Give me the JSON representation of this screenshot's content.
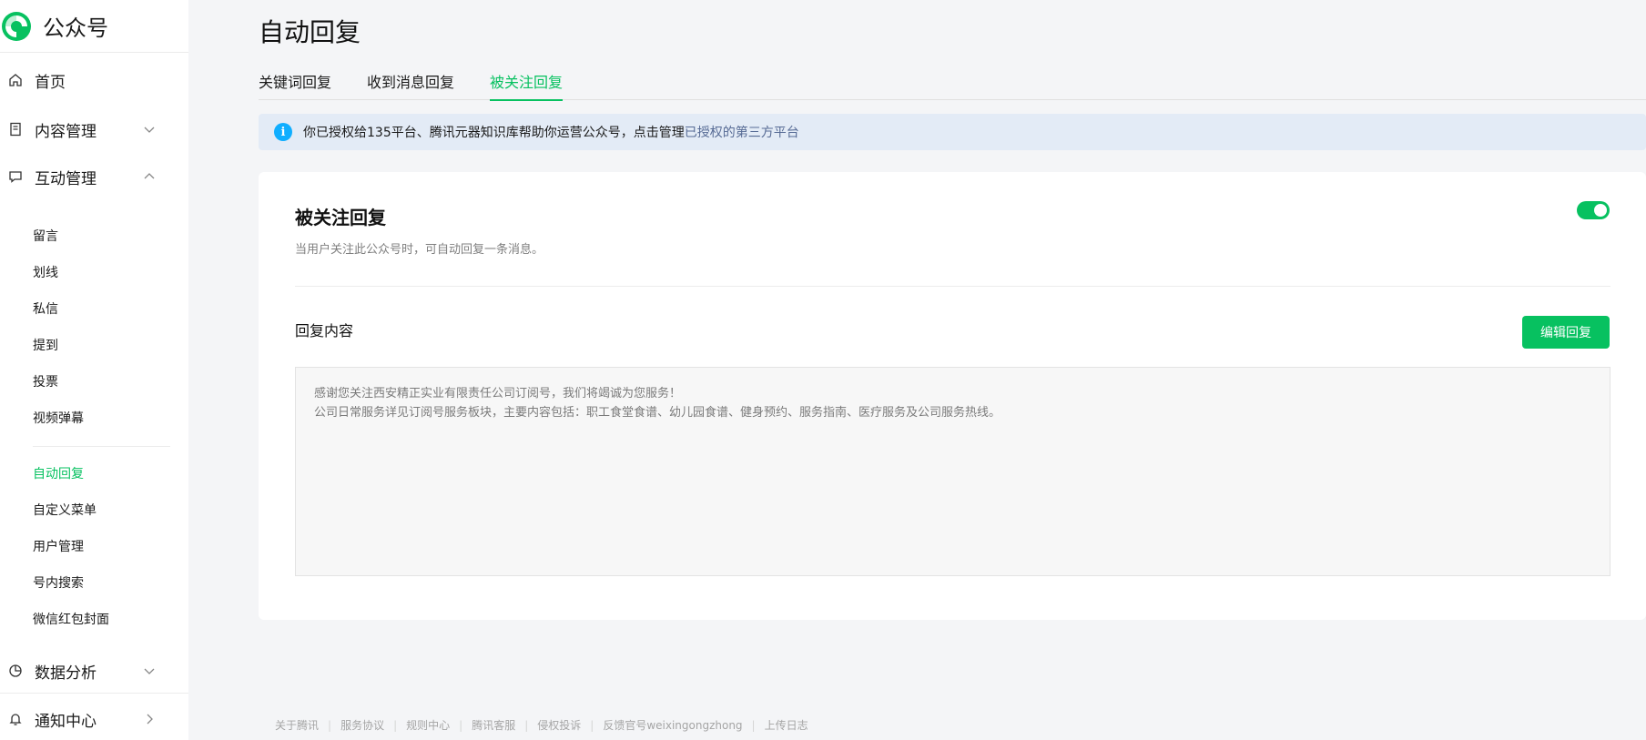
{
  "brand": {
    "name": "公众号",
    "logo_icon": "wechat-mp-logo-icon",
    "accent": "#07c160"
  },
  "sidebar": {
    "top_items": [
      {
        "label": "首页",
        "icon": "home-icon"
      },
      {
        "label": "内容管理",
        "icon": "document-icon",
        "expanded": false
      },
      {
        "label": "互动管理",
        "icon": "chat-bubble-icon",
        "expanded": true
      }
    ],
    "interaction_items": [
      {
        "label": "留言"
      },
      {
        "label": "划线"
      },
      {
        "label": "私信"
      },
      {
        "label": "提到"
      },
      {
        "label": "投票"
      },
      {
        "label": "视频弹幕"
      }
    ],
    "reply_items": [
      {
        "label": "自动回复",
        "active": true
      },
      {
        "label": "自定义菜单"
      },
      {
        "label": "用户管理"
      },
      {
        "label": "号内搜索"
      },
      {
        "label": "微信红包封面"
      }
    ],
    "bottom_items": [
      {
        "label": "数据分析",
        "icon": "pie-chart-icon"
      },
      {
        "label": "通知中心",
        "icon": "bell-icon"
      }
    ]
  },
  "page": {
    "title": "自动回复"
  },
  "tabs": [
    {
      "label": "关键词回复",
      "active": false
    },
    {
      "label": "收到消息回复",
      "active": false
    },
    {
      "label": "被关注回复",
      "active": true
    }
  ],
  "notice": {
    "text": "你已授权给135平台、腾讯元器知识库帮助你运营公众号，点击管理",
    "link": "已授权的第三方平台"
  },
  "card": {
    "title": "被关注回复",
    "description": "当用户关注此公众号时，可自动回复一条消息。",
    "toggle_on": true,
    "reply_label": "回复内容",
    "edit_button": "编辑回复",
    "reply_lines": [
      "感谢您关注西安精正实业有限责任公司订阅号，我们将竭诚为您服务！",
      "公司日常服务详见订阅号服务板块，主要内容包括：职工食堂食谱、幼儿园食谱、健身预约、服务指南、医疗服务及公司服务热线。"
    ]
  },
  "footer": {
    "links": [
      "关于腾讯",
      "服务协议",
      "规则中心",
      "腾讯客服",
      "侵权投诉",
      "反馈官号weixingongzhong",
      "上传日志"
    ]
  }
}
